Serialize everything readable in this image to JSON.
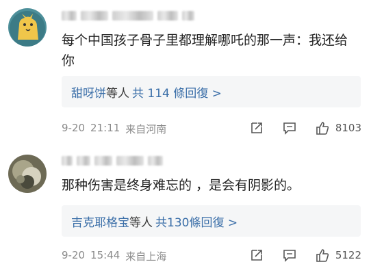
{
  "comments": [
    {
      "text": "每个中国孩子骨子里都理解哪吒的那一声：我还给你",
      "reply": {
        "names": "甜呀饼",
        "mid": "等人",
        "count": "共 114 條回復 >"
      },
      "meta": {
        "date": "9-20",
        "time": "21:11",
        "location": "来自河南"
      },
      "likes": "8103"
    },
    {
      "text": "那种伤害是终身难忘的 ，是会有阴影的。",
      "reply": {
        "names": "吉克耶格宝",
        "mid": "等人",
        "count": "共130條回復 >"
      },
      "meta": {
        "date": "9-20",
        "time": "15:44",
        "location": "来自上海"
      },
      "likes": "5122"
    }
  ],
  "icons": {
    "share": "share-icon",
    "comment": "comment-icon",
    "like": "thumbs-up-icon"
  },
  "colors": {
    "link": "#3a6ea8",
    "meta": "#8a8a8a",
    "reply_bg": "#f5f6f7"
  }
}
